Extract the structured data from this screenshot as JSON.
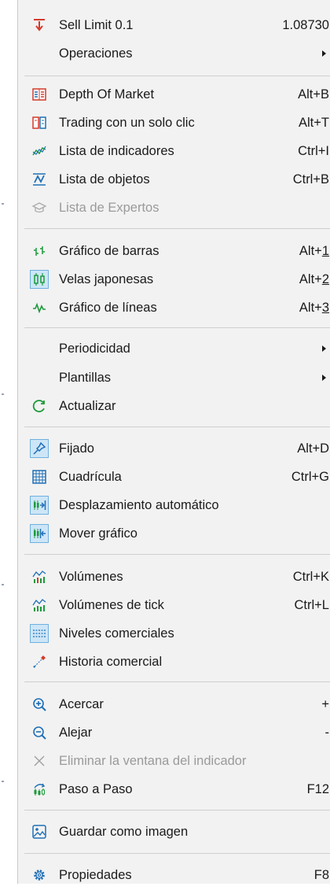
{
  "menu": {
    "sell_limit": {
      "label": "Sell Limit 0.1",
      "value": "1.08730"
    },
    "operaciones": {
      "label": "Operaciones"
    },
    "depth_of_market": {
      "label": "Depth Of Market",
      "shortcut": "Alt+B"
    },
    "one_click": {
      "label": "Trading con un solo clic",
      "shortcut": "Alt+T"
    },
    "indicators": {
      "label": "Lista de indicadores",
      "shortcut": "Ctrl+I"
    },
    "objects": {
      "label": "Lista de objetos",
      "shortcut": "Ctrl+B"
    },
    "experts": {
      "label": "Lista de Expertos"
    },
    "bars": {
      "label": "Gráfico de barras",
      "sc_prefix": "Alt+",
      "sc_key": "1"
    },
    "candles": {
      "label": "Velas japonesas",
      "sc_prefix": "Alt+",
      "sc_key": "2"
    },
    "lines": {
      "label": "Gráfico de líneas",
      "sc_prefix": "Alt+",
      "sc_key": "3"
    },
    "periodicidad": {
      "label": "Periodicidad"
    },
    "plantillas": {
      "label": "Plantillas"
    },
    "actualizar": {
      "label": "Actualizar"
    },
    "fijado": {
      "label": "Fijado",
      "shortcut": "Alt+D"
    },
    "cuadricula": {
      "label": "Cuadrícula",
      "shortcut": "Ctrl+G"
    },
    "autoscroll": {
      "label": "Desplazamiento automático"
    },
    "mover": {
      "label": "Mover gráfico"
    },
    "volumenes": {
      "label": "Volúmenes",
      "shortcut": "Ctrl+K"
    },
    "tick_volumes": {
      "label": "Volúmenes de tick",
      "shortcut": "Ctrl+L"
    },
    "trade_levels": {
      "label": "Niveles comerciales"
    },
    "trade_history": {
      "label": "Historia comercial"
    },
    "acercar": {
      "label": "Acercar",
      "shortcut": "+"
    },
    "alejar": {
      "label": "Alejar",
      "shortcut": "-"
    },
    "delete_indicator_window": {
      "label": "Eliminar la ventana del indicador"
    },
    "step": {
      "label": "Paso a Paso",
      "shortcut": "F12"
    },
    "save_image": {
      "label": "Guardar como imagen"
    },
    "properties": {
      "label": "Propiedades",
      "shortcut": "F8"
    }
  },
  "colors": {
    "menu_bg": "#f2f2f2",
    "check_bg": "#cde6f7",
    "check_border": "#6fb0e0",
    "icon_blue": "#1f6fb6",
    "icon_green": "#1c9a3a",
    "icon_red": "#d43a2a",
    "disabled_text": "#9a9a9a"
  },
  "icons": [
    "sell-limit-icon",
    "depth-of-market-icon",
    "one-click-trading-icon",
    "indicators-icon",
    "objects-icon",
    "experts-icon",
    "bar-chart-icon",
    "candlestick-icon",
    "line-chart-icon",
    "refresh-icon",
    "pin-icon",
    "grid-icon",
    "autoscroll-icon",
    "chart-shift-icon",
    "volumes-icon",
    "tick-volumes-icon",
    "trade-levels-icon",
    "trade-history-icon",
    "zoom-in-icon",
    "zoom-out-icon",
    "close-icon",
    "step-icon",
    "image-icon",
    "gear-icon"
  ]
}
